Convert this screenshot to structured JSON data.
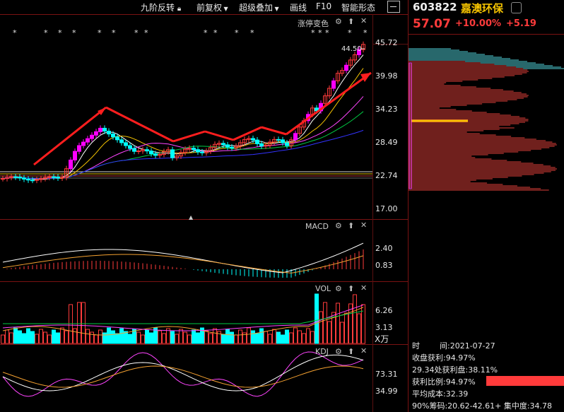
{
  "toolbar": {
    "items": [
      "九阶反转",
      "前复权",
      "超级叠加",
      "画线",
      "F10",
      "智能形态"
    ]
  },
  "stock": {
    "code": "603822",
    "name": "嘉澳环保",
    "price": "57.07",
    "pct": "+10.00%",
    "change": "+5.19"
  },
  "main_panel": {
    "indicator": "涨停变色",
    "peak_label": "44.50",
    "y_ticks": [
      "45.72",
      "39.98",
      "34.23",
      "28.49",
      "22.74",
      "17.00"
    ]
  },
  "macd_panel": {
    "title": "MACD",
    "y_ticks": [
      "2.40",
      "0.83"
    ]
  },
  "vol_panel": {
    "title": "VOL",
    "y_ticks": [
      "6.26",
      "3.13"
    ],
    "unit": "X万"
  },
  "kdj_panel": {
    "title": "KDJ",
    "y_ticks": [
      "73.31",
      "34.99"
    ]
  },
  "chip_info": {
    "time_label": "时",
    "time_sep": "间:",
    "date": "2021-07-27",
    "close_profit": "收盘获利:94.97%",
    "price_profit": "29.34处获利盘:38.11%",
    "profit_ratio": "获利比例:94.97%",
    "avg_cost": "平均成本:32.39",
    "chip_range": "90%筹码:20.62-42.61+",
    "concentration": "集中度:34.78"
  },
  "colors": {
    "up": "#ff3b3b",
    "down": "#00ffff",
    "accent": "#f3c200",
    "border": "#7a1212"
  }
}
